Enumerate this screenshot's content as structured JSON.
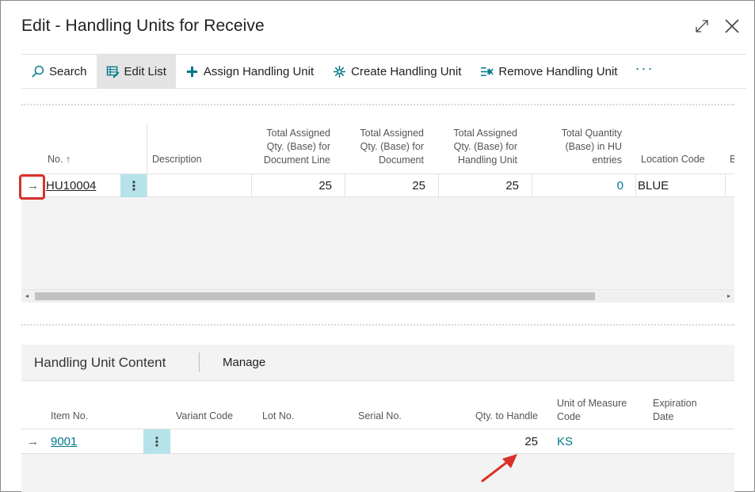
{
  "dialog": {
    "title": "Edit - Handling Units for Receive"
  },
  "toolbar": {
    "search": "Search",
    "edit_list": "Edit List",
    "assign": "Assign Handling Unit",
    "create": "Create Handling Unit",
    "remove": "Remove Handling Unit",
    "more": "···"
  },
  "grid1": {
    "columns": {
      "no": "No. ↑",
      "description": "Description",
      "tot_doc_line": [
        "Total Assigned",
        "Qty. (Base) for",
        "Document Line"
      ],
      "tot_doc": [
        "Total Assigned",
        "Qty. (Base) for",
        "Document"
      ],
      "tot_hu": [
        "Total Assigned",
        "Qty. (Base) for",
        "Handling Unit"
      ],
      "tot_qty_entries": [
        "Total Quantity",
        "(Base) in HU",
        "entries"
      ],
      "location": "Location Code",
      "next": "B"
    },
    "rows": [
      {
        "arrow": "→",
        "no": "HU10004",
        "kebab": "⋮",
        "description": "",
        "tot_doc_line": "25",
        "tot_doc": "25",
        "tot_hu": "25",
        "tot_qty_entries": "0",
        "location": "BLUE"
      }
    ]
  },
  "part": {
    "title": "Handling Unit Content",
    "manage": "Manage",
    "columns": {
      "item_no": "Item No.",
      "variant": "Variant Code",
      "lot": "Lot No.",
      "serial": "Serial No.",
      "qty": "Qty. to Handle",
      "uom": [
        "Unit of Measure",
        "Code"
      ],
      "exp": [
        "Expiration",
        "Date"
      ]
    },
    "rows": [
      {
        "arrow": "→",
        "item_no": "9001",
        "kebab": "⋮",
        "qty": "25",
        "uom": "KS"
      }
    ]
  },
  "colors": {
    "accent": "#00788a",
    "highlight": "#d9312a",
    "kebab_bg": "#b6e3ea"
  }
}
